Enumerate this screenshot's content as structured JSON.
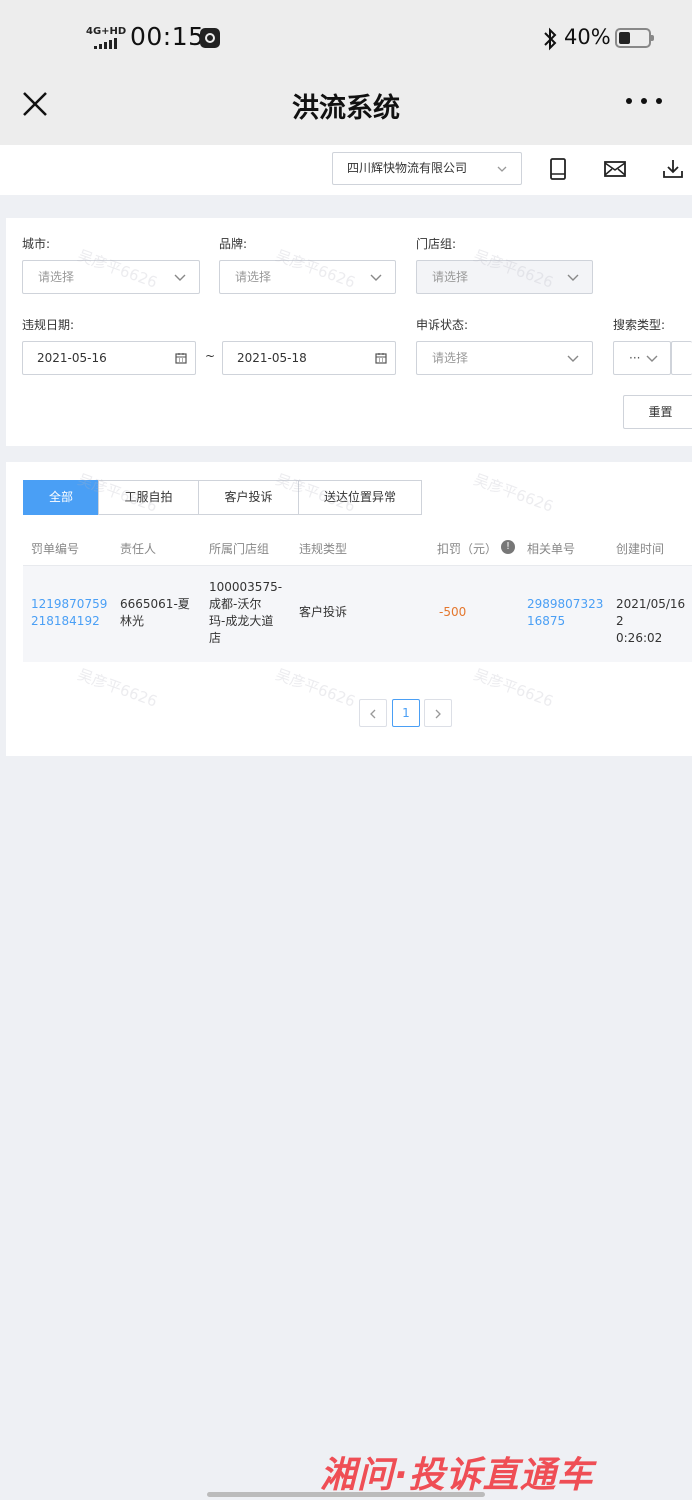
{
  "status_bar": {
    "network": "4G+HD",
    "time": "00:15",
    "battery_percent": "40%",
    "battery_level": 0.4
  },
  "nav": {
    "title": "洪流系统"
  },
  "toolbar": {
    "company": "四川辉快物流有限公司",
    "icons": [
      "tablet-icon",
      "mail-icon",
      "download-icon"
    ]
  },
  "filters": {
    "city": {
      "label": "城市:",
      "placeholder": "请选择"
    },
    "brand": {
      "label": "品牌:",
      "placeholder": "请选择"
    },
    "store_group": {
      "label": "门店组:",
      "placeholder": "请选择"
    },
    "violation_date": {
      "label": "违规日期:",
      "start": "2021-05-16",
      "separator": "~",
      "end": "2021-05-18"
    },
    "appeal_status": {
      "label": "申诉状态:",
      "placeholder": "请选择"
    },
    "search_type": {
      "label": "搜索类型:",
      "value": "···"
    },
    "reset_label": "重置"
  },
  "tabs": [
    {
      "label": "全部",
      "active": true
    },
    {
      "label": "工服自拍",
      "active": false
    },
    {
      "label": "客户投诉",
      "active": false
    },
    {
      "label": "送达位置异常",
      "active": false
    }
  ],
  "table": {
    "headers": [
      "罚单编号",
      "责任人",
      "所属门店组",
      "违规类型",
      "扣罚（元）",
      "相关单号",
      "创建时间"
    ],
    "info_glyph": "!",
    "rows": [
      {
        "ticket_no_1": "1219870759",
        "ticket_no_2": "218184192",
        "responsible_1": "6665061-夏",
        "responsible_2": "林光",
        "store_1": "100003575-",
        "store_2": "成都-沃尔",
        "store_3": "玛-成龙大道",
        "store_4": "店",
        "violation_type": "客户投诉",
        "penalty": "-500",
        "related_1": "2989807323",
        "related_2": "16875",
        "created_1": "2021/05/16 2",
        "created_2": "0:26:02"
      }
    ]
  },
  "pagination": {
    "current_page": "1"
  },
  "watermark_text": "吴彦平6626",
  "banner": "湘问·投诉直通车"
}
